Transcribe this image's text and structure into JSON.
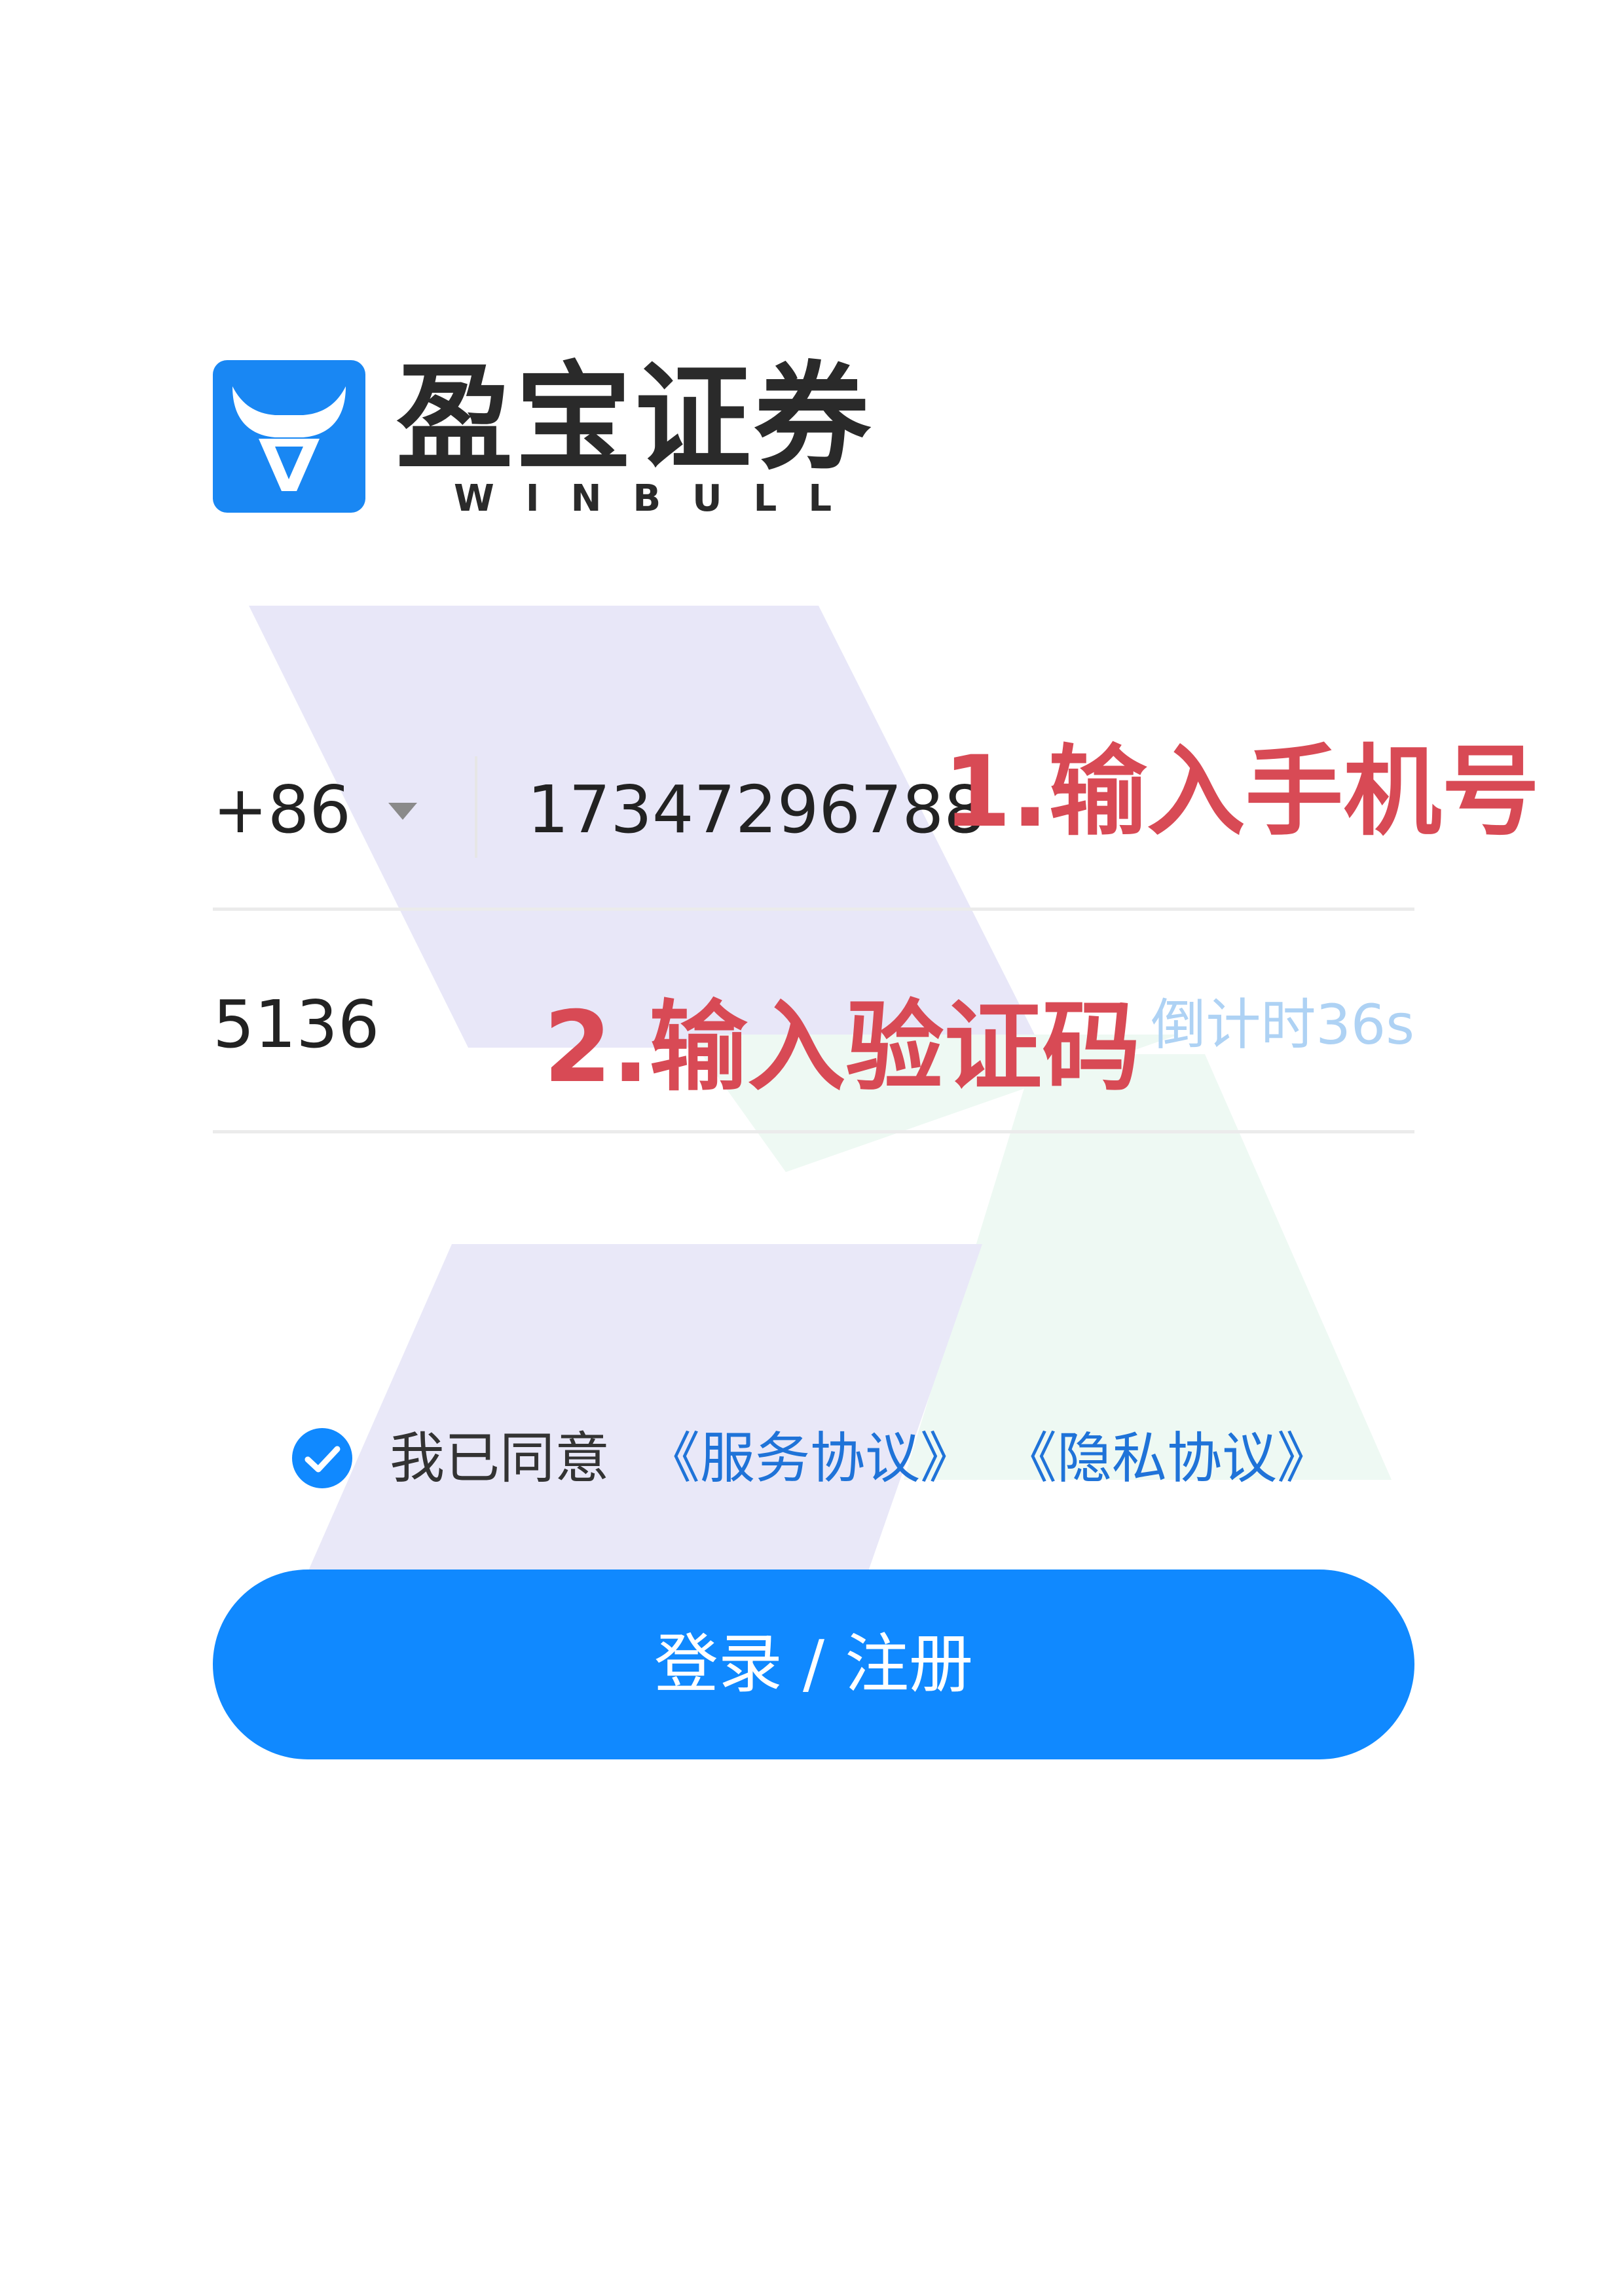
{
  "brand": {
    "name": "盈宝证券",
    "subtitle": "WINBULL",
    "logo_icon": "bull-head-icon",
    "color": "#1987f3"
  },
  "phone": {
    "country_code": "+86",
    "dropdown_icon": "caret-down-icon",
    "value": "17347296788"
  },
  "verification": {
    "value": "5136",
    "countdown": "倒计时36s"
  },
  "annotations": {
    "step1": "1.输入手机号",
    "step2": "2.输入验证码",
    "color": "#d84a55"
  },
  "agreement": {
    "checked": true,
    "check_icon": "checkmark-circle-icon",
    "prefix": "我已同意",
    "service_link": "《服务协议》",
    "privacy_link": "《隐私协议》",
    "link_color": "#1f73d8"
  },
  "login_button": {
    "label": "登录 / 注册",
    "color": "#1089ff"
  }
}
